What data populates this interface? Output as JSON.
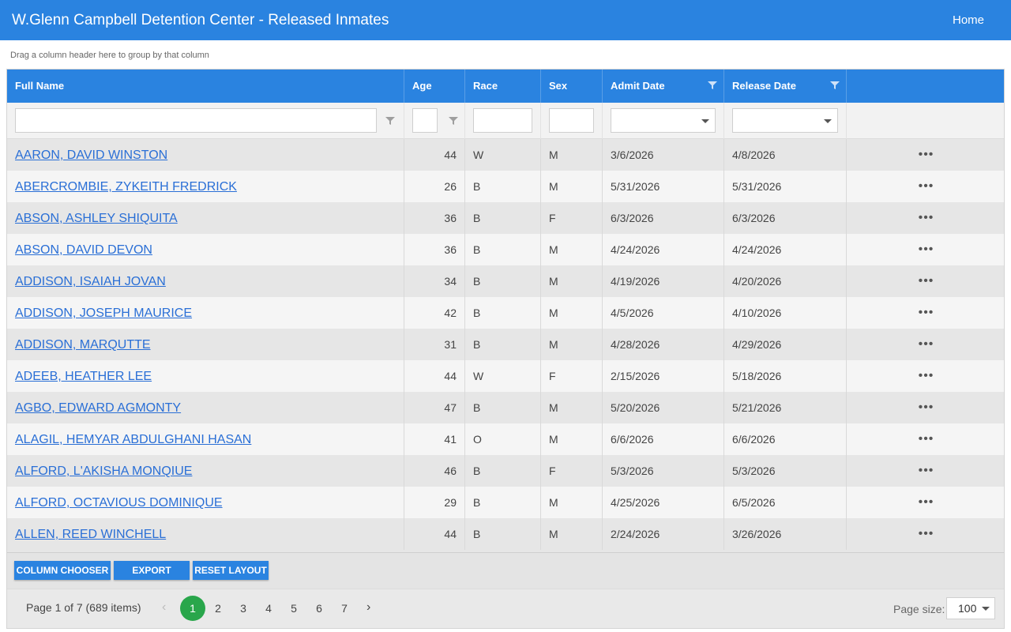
{
  "header": {
    "title": "W.Glenn Campbell Detention Center - Released Inmates",
    "home_label": "Home"
  },
  "group_hint": "Drag a column header here to group by that column",
  "columns": {
    "full_name": "Full Name",
    "age": "Age",
    "race": "Race",
    "sex": "Sex",
    "admit_date": "Admit Date",
    "release_date": "Release Date"
  },
  "rows": [
    {
      "name": "AARON, DAVID WINSTON",
      "age": "44",
      "race": "W",
      "sex": "M",
      "admit": "3/6/2026",
      "release": "4/8/2026"
    },
    {
      "name": "ABERCROMBIE, ZYKEITH FREDRICK",
      "age": "26",
      "race": "B",
      "sex": "M",
      "admit": "5/31/2026",
      "release": "5/31/2026"
    },
    {
      "name": "ABSON, ASHLEY SHIQUITA",
      "age": "36",
      "race": "B",
      "sex": "F",
      "admit": "6/3/2026",
      "release": "6/3/2026"
    },
    {
      "name": "ABSON, DAVID DEVON",
      "age": "36",
      "race": "B",
      "sex": "M",
      "admit": "4/24/2026",
      "release": "4/24/2026"
    },
    {
      "name": "ADDISON, ISAIAH JOVAN",
      "age": "34",
      "race": "B",
      "sex": "M",
      "admit": "4/19/2026",
      "release": "4/20/2026"
    },
    {
      "name": "ADDISON, JOSEPH MAURICE",
      "age": "42",
      "race": "B",
      "sex": "M",
      "admit": "4/5/2026",
      "release": "4/10/2026"
    },
    {
      "name": "ADDISON, MARQUTTE",
      "age": "31",
      "race": "B",
      "sex": "M",
      "admit": "4/28/2026",
      "release": "4/29/2026"
    },
    {
      "name": "ADEEB, HEATHER LEE",
      "age": "44",
      "race": "W",
      "sex": "F",
      "admit": "2/15/2026",
      "release": "5/18/2026"
    },
    {
      "name": "AGBO, EDWARD AGMONTY",
      "age": "47",
      "race": "B",
      "sex": "M",
      "admit": "5/20/2026",
      "release": "5/21/2026"
    },
    {
      "name": "ALAGIL, HEMYAR ABDULGHANI HASAN",
      "age": "41",
      "race": "O",
      "sex": "M",
      "admit": "6/6/2026",
      "release": "6/6/2026"
    },
    {
      "name": "ALFORD, L'AKISHA MONQIUE",
      "age": "46",
      "race": "B",
      "sex": "F",
      "admit": "5/3/2026",
      "release": "5/3/2026"
    },
    {
      "name": "ALFORD, OCTAVIOUS DOMINIQUE",
      "age": "29",
      "race": "B",
      "sex": "M",
      "admit": "4/25/2026",
      "release": "6/5/2026"
    },
    {
      "name": "ALLEN, REED WINCHELL",
      "age": "44",
      "race": "B",
      "sex": "M",
      "admit": "2/24/2026",
      "release": "3/26/2026"
    }
  ],
  "row_menu_glyph": "•••",
  "toolbar": {
    "column_chooser": "COLUMN CHOOSER",
    "export": "EXPORT",
    "reset_layout": "RESET LAYOUT"
  },
  "pager": {
    "info": "Page 1 of 7 (689 items)",
    "pages": [
      "1",
      "2",
      "3",
      "4",
      "5",
      "6",
      "7"
    ],
    "current": "1",
    "prev_glyph": "‹",
    "next_glyph": "›",
    "page_size_label": "Page size:",
    "page_size": "100"
  },
  "colors": {
    "accent": "#2a83e0",
    "active_page": "#29a64b",
    "link": "#2a6fd6"
  }
}
